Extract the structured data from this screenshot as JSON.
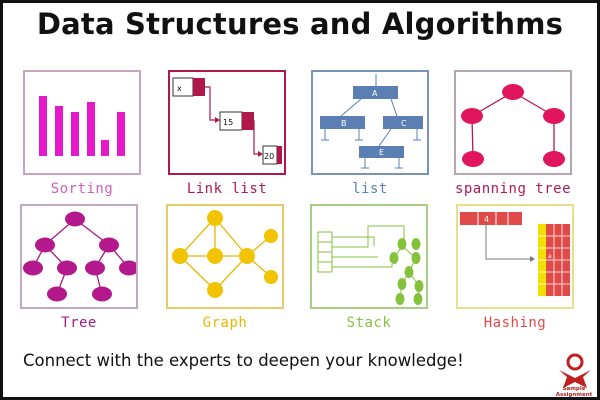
{
  "header": {
    "title": "Data Structures and Algorithms"
  },
  "cards": {
    "sorting": {
      "label": "Sorting",
      "color": "#e619c8"
    },
    "linklist": {
      "label": "Link list",
      "color": "#b0174a",
      "nodes": [
        "x",
        "15",
        "20"
      ]
    },
    "list": {
      "label": "list",
      "color": "#5b7fb3",
      "nodes": [
        "A",
        "B",
        "C",
        "E"
      ]
    },
    "spanning": {
      "label": "spanning tree",
      "color": "#b01859"
    },
    "tree": {
      "label": "Tree",
      "color": "#a51a83"
    },
    "graph": {
      "label": "Graph",
      "color": "#e6b800"
    },
    "stack": {
      "label": "Stack",
      "color": "#84c23c"
    },
    "hashing": {
      "label": "Hashing",
      "color": "#e04a48",
      "key": "4",
      "entry": "a"
    }
  },
  "footer": {
    "text": "Connect with the experts to deepen your knowledge!"
  },
  "logo": {
    "name": "sample-assignment-logo",
    "text": "Sample Assignment"
  }
}
